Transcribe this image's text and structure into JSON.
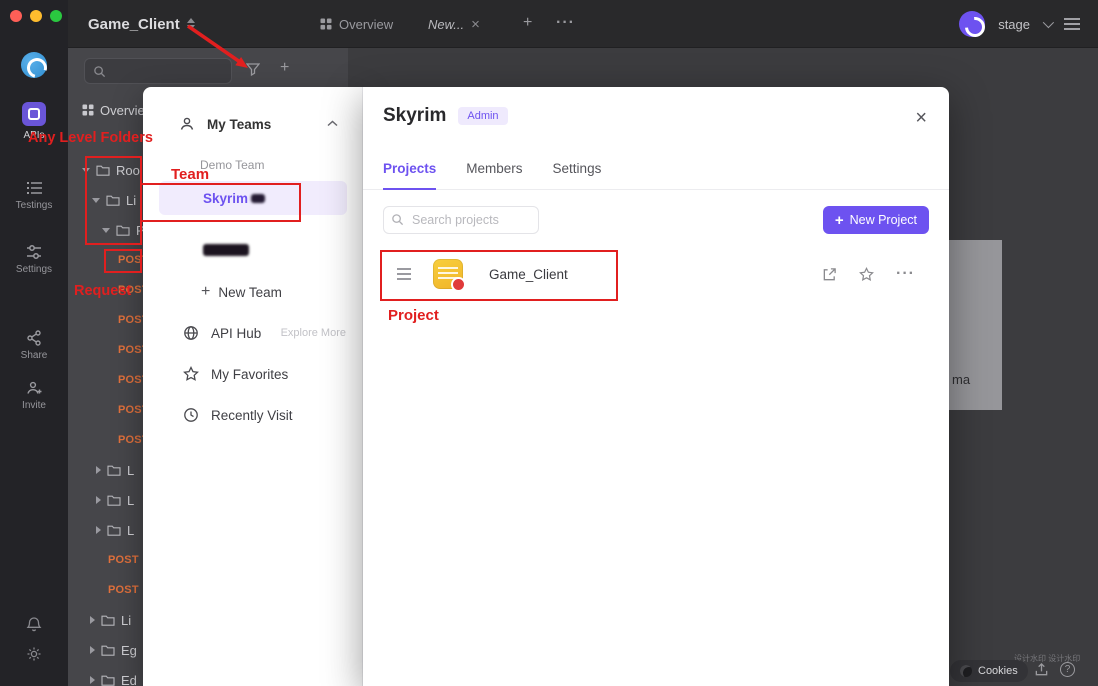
{
  "colors": {
    "accent_purple": "#6d52f0",
    "annotation_red": "#e11f1f",
    "method_post_orange": "#e0703c"
  },
  "header": {
    "title": "Game_Client",
    "tabs": [
      {
        "label": "Overview"
      },
      {
        "label": "New..."
      }
    ],
    "env_name": "stage"
  },
  "sidebar": {
    "items": [
      {
        "label": "APIs"
      },
      {
        "label": "Testings"
      },
      {
        "label": "Settings"
      },
      {
        "label": "Share"
      },
      {
        "label": "Invite"
      }
    ]
  },
  "tree": {
    "overview_label": "Overview",
    "method_post": "POST",
    "folders": [
      "Roo",
      "Li",
      "P",
      "L",
      "L",
      "L",
      "Li",
      "Eg",
      "Ed"
    ]
  },
  "team_panel": {
    "my_teams_label": "My Teams",
    "group_label": "Demo Team",
    "active_team": "Skyrim",
    "new_team_label": "New Team",
    "api_hub_label": "API Hub",
    "explore_more_label": "Explore More",
    "favorites_label": "My Favorites",
    "recent_label": "Recently Visit"
  },
  "modal": {
    "title": "Skyrim",
    "badge": "Admin",
    "tabs": [
      {
        "label": "Projects"
      },
      {
        "label": "Members"
      },
      {
        "label": "Settings"
      }
    ],
    "search_placeholder": "Search projects",
    "new_project_label": "New Project",
    "project": {
      "name": "Game_Client"
    }
  },
  "right_panel": {
    "fragment": "ma"
  },
  "footer": {
    "cookies_label": "Cookies",
    "watermark": "设计水印 设计水印"
  },
  "annotations": {
    "any_level_folders": "Any Level Folders",
    "team": "Team",
    "request": "Request",
    "project": "Project"
  }
}
